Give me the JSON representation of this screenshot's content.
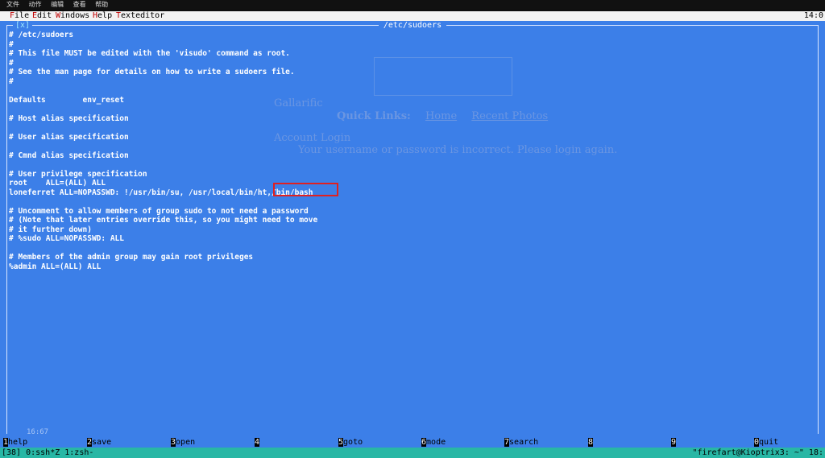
{
  "system_menu": [
    "文件",
    "动作",
    "编辑",
    "查看",
    "帮助"
  ],
  "menubar": {
    "items": [
      {
        "label": "File",
        "hot": "F"
      },
      {
        "label": "Edit",
        "hot": "E"
      },
      {
        "label": "Windows",
        "hot": "W"
      },
      {
        "label": "Help",
        "hot": "H"
      },
      {
        "label": "Texteditor",
        "hot": "T"
      }
    ],
    "clock": "14:0"
  },
  "window": {
    "close_label": "[x]",
    "title": "/etc/sudoers",
    "status": "16:67",
    "lines": [
      "# /etc/sudoers",
      "#",
      "# This file MUST be edited with the 'visudo' command as root.",
      "#",
      "# See the man page for details on how to write a sudoers file.",
      "#",
      "",
      "Defaults        env_reset",
      "",
      "# Host alias specification",
      "",
      "# User alias specification",
      "",
      "# Cmnd alias specification",
      "",
      "# User privilege specification",
      "root    ALL=(ALL) ALL",
      "loneferret ALL=NOPASSWD: !/usr/bin/su, /usr/local/bin/ht,/bin/bash",
      "",
      "# Uncomment to allow members of group sudo to not need a password",
      "# (Note that later entries override this, so you might need to move",
      "# it further down)",
      "# %sudo ALL=NOPASSWD: ALL",
      "",
      "# Members of the admin group may gain root privileges",
      "%admin ALL=(ALL) ALL"
    ]
  },
  "background_page": {
    "title": "Gallarific",
    "quick_links_label": "Quick Links:",
    "home": "Home",
    "recent_photos": "Recent Photos",
    "account_login": "Account Login",
    "error": "Your username or password is incorrect. Please login again."
  },
  "fkeys": [
    {
      "num": "1",
      "label": "help"
    },
    {
      "num": "2",
      "label": "save"
    },
    {
      "num": "3",
      "label": "open"
    },
    {
      "num": "4",
      "label": ""
    },
    {
      "num": "5",
      "label": "goto"
    },
    {
      "num": "6",
      "label": "mode"
    },
    {
      "num": "7",
      "label": "search"
    },
    {
      "num": "8",
      "label": ""
    },
    {
      "num": "9",
      "label": ""
    },
    {
      "num": "0",
      "label": "quit"
    }
  ],
  "tmux": {
    "left": "[38] 0:ssh*Z 1:zsh-",
    "right": "\"firefart@Kioptrix3: ~\" 18:"
  }
}
